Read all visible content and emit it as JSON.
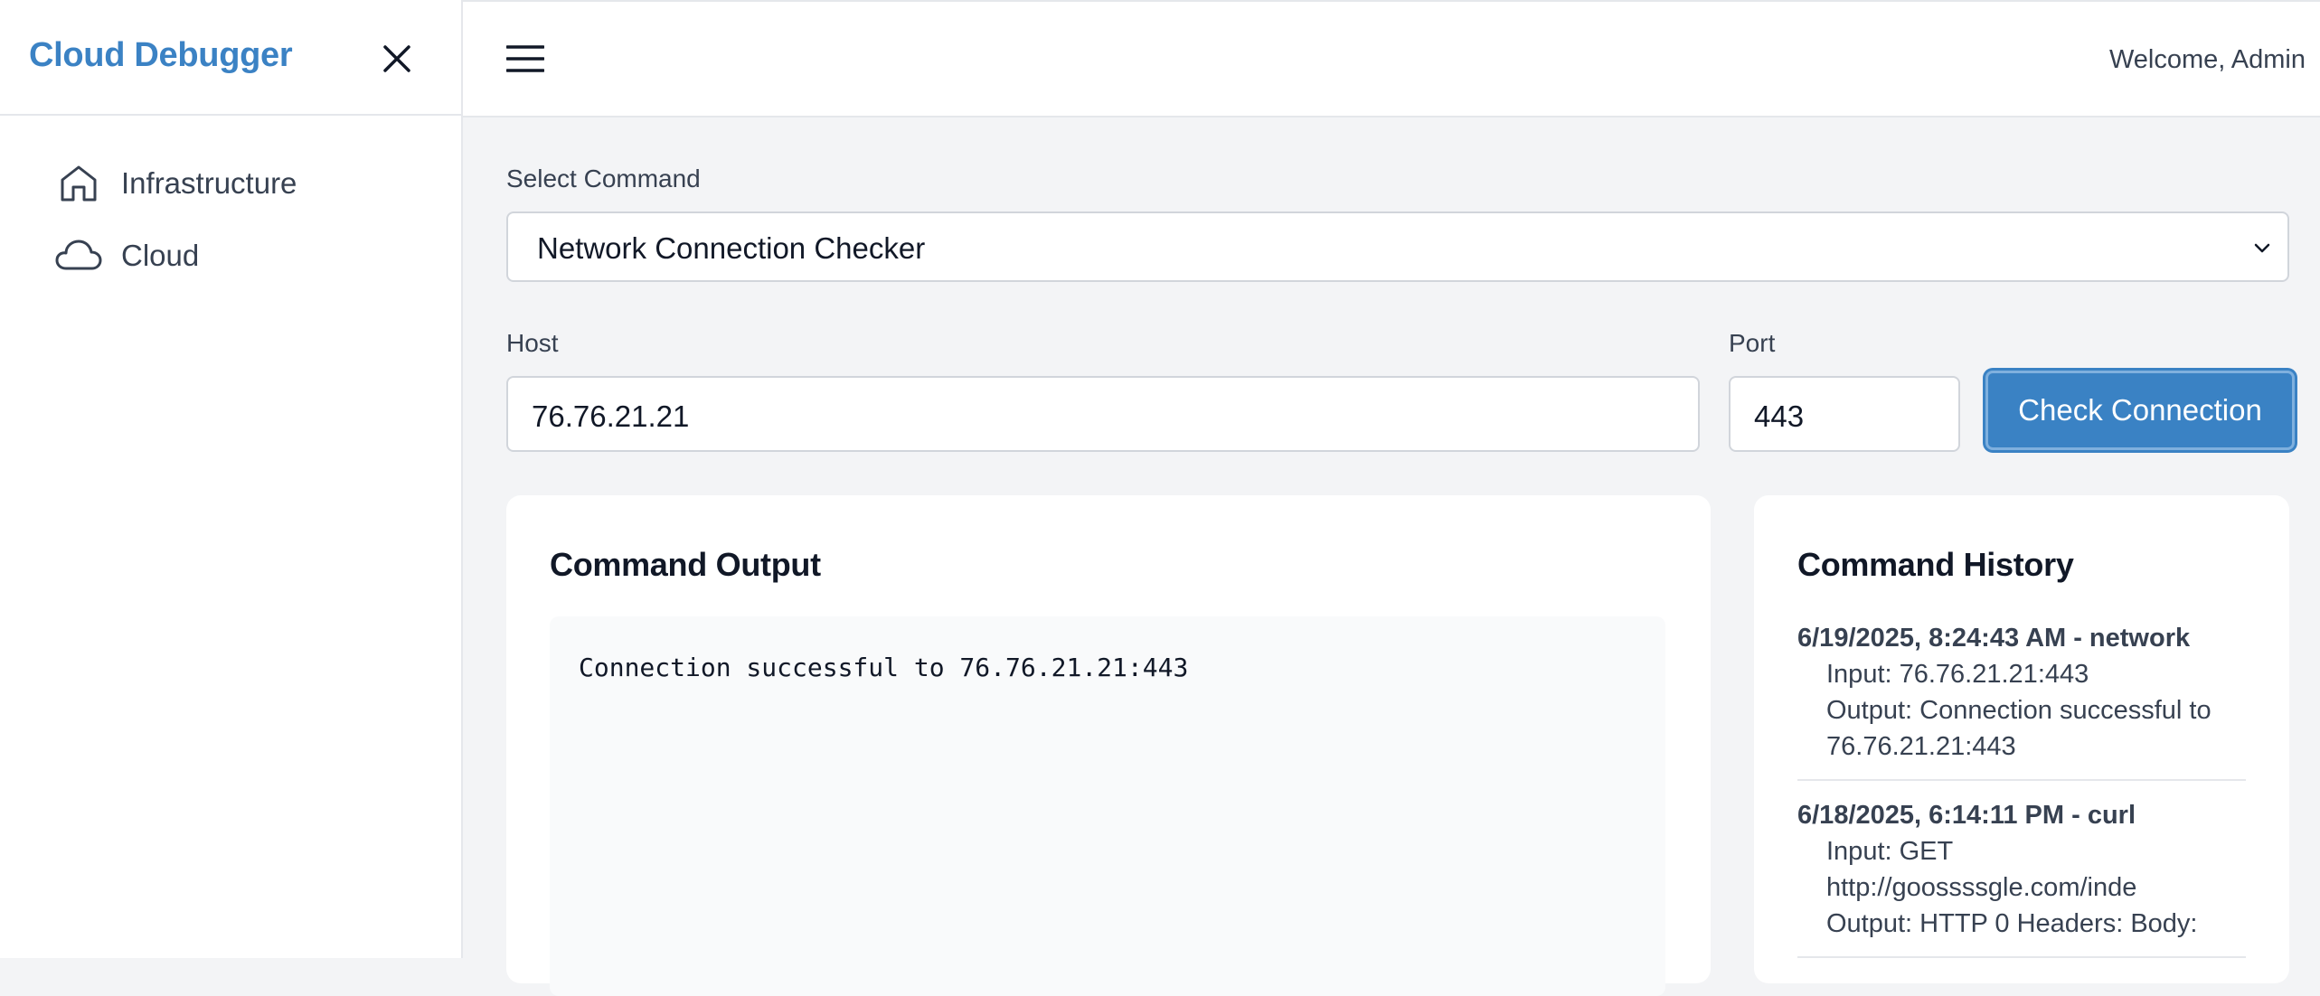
{
  "app": {
    "brand": "Cloud Debugger"
  },
  "sidebar": {
    "items": [
      {
        "label": "Infrastructure",
        "icon": "home-icon"
      },
      {
        "label": "Cloud",
        "icon": "cloud-icon"
      }
    ]
  },
  "topbar": {
    "welcome": "Welcome, Admin"
  },
  "form": {
    "command_label": "Select Command",
    "command_value": "Network Connection Checker",
    "host_label": "Host",
    "host_value": "76.76.21.21",
    "port_label": "Port",
    "port_value": "443",
    "submit_label": "Check Connection"
  },
  "output": {
    "title": "Command Output",
    "text": "Connection successful to 76.76.21.21:443"
  },
  "history": {
    "title": "Command History",
    "items": [
      {
        "head": "6/19/2025, 8:24:43 AM - network",
        "input": "Input: 76.76.21.21:443",
        "output_1": "Output: Connection successful to",
        "output_2": "76.76.21.21:443"
      },
      {
        "head": "6/18/2025, 6:14:11 PM - curl",
        "input_1": "Input: GET",
        "input_2": "http://goossssgle.com/inde",
        "output_1": "Output: HTTP 0 Headers: Body:"
      }
    ]
  },
  "colors": {
    "brand": "#3b82c4",
    "button": "#3a82c4",
    "background": "#f3f4f6"
  }
}
